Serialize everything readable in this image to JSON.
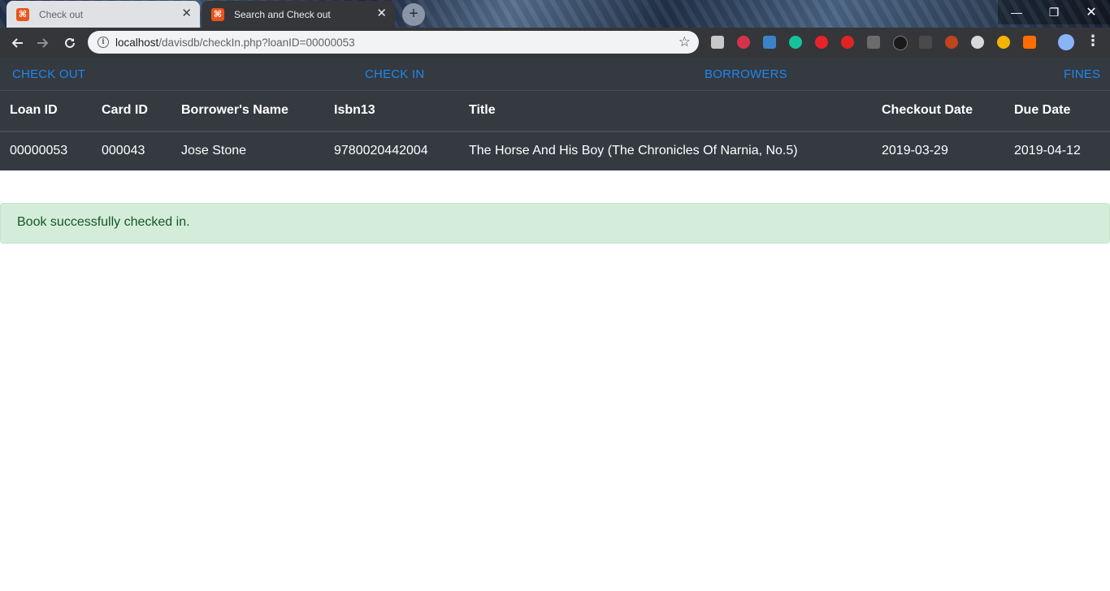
{
  "browser": {
    "tabs": [
      {
        "title": "Check out",
        "favicon": "xampp-icon",
        "active": false
      },
      {
        "title": "Search and Check out",
        "favicon": "xampp-icon",
        "active": true
      }
    ],
    "new_tab_label": "+",
    "url_host": "localhost",
    "url_path": "/davisdb/checkIn.php?loanID=00000053",
    "window_controls": {
      "minimize": "—",
      "maximize": "❐",
      "close": "✕"
    }
  },
  "nav": {
    "check_out": "CHECK OUT",
    "check_in": "CHECK IN",
    "borrowers": "BORROWERS",
    "fines": "FINES"
  },
  "table": {
    "headers": [
      "Loan ID",
      "Card ID",
      "Borrower's Name",
      "Isbn13",
      "Title",
      "Checkout Date",
      "Due Date"
    ],
    "rows": [
      [
        "00000053",
        "000043",
        "Jose Stone",
        "9780020442004",
        "The Horse And His Boy (The Chronicles Of Narnia, No.5)",
        "2019-03-29",
        "2019-04-12"
      ]
    ]
  },
  "alert": {
    "message": "Book successfully checked in."
  },
  "colors": {
    "nav_bg": "#343a40",
    "nav_link": "#1e87f0",
    "alert_bg": "#d4edda",
    "alert_text": "#155724"
  }
}
